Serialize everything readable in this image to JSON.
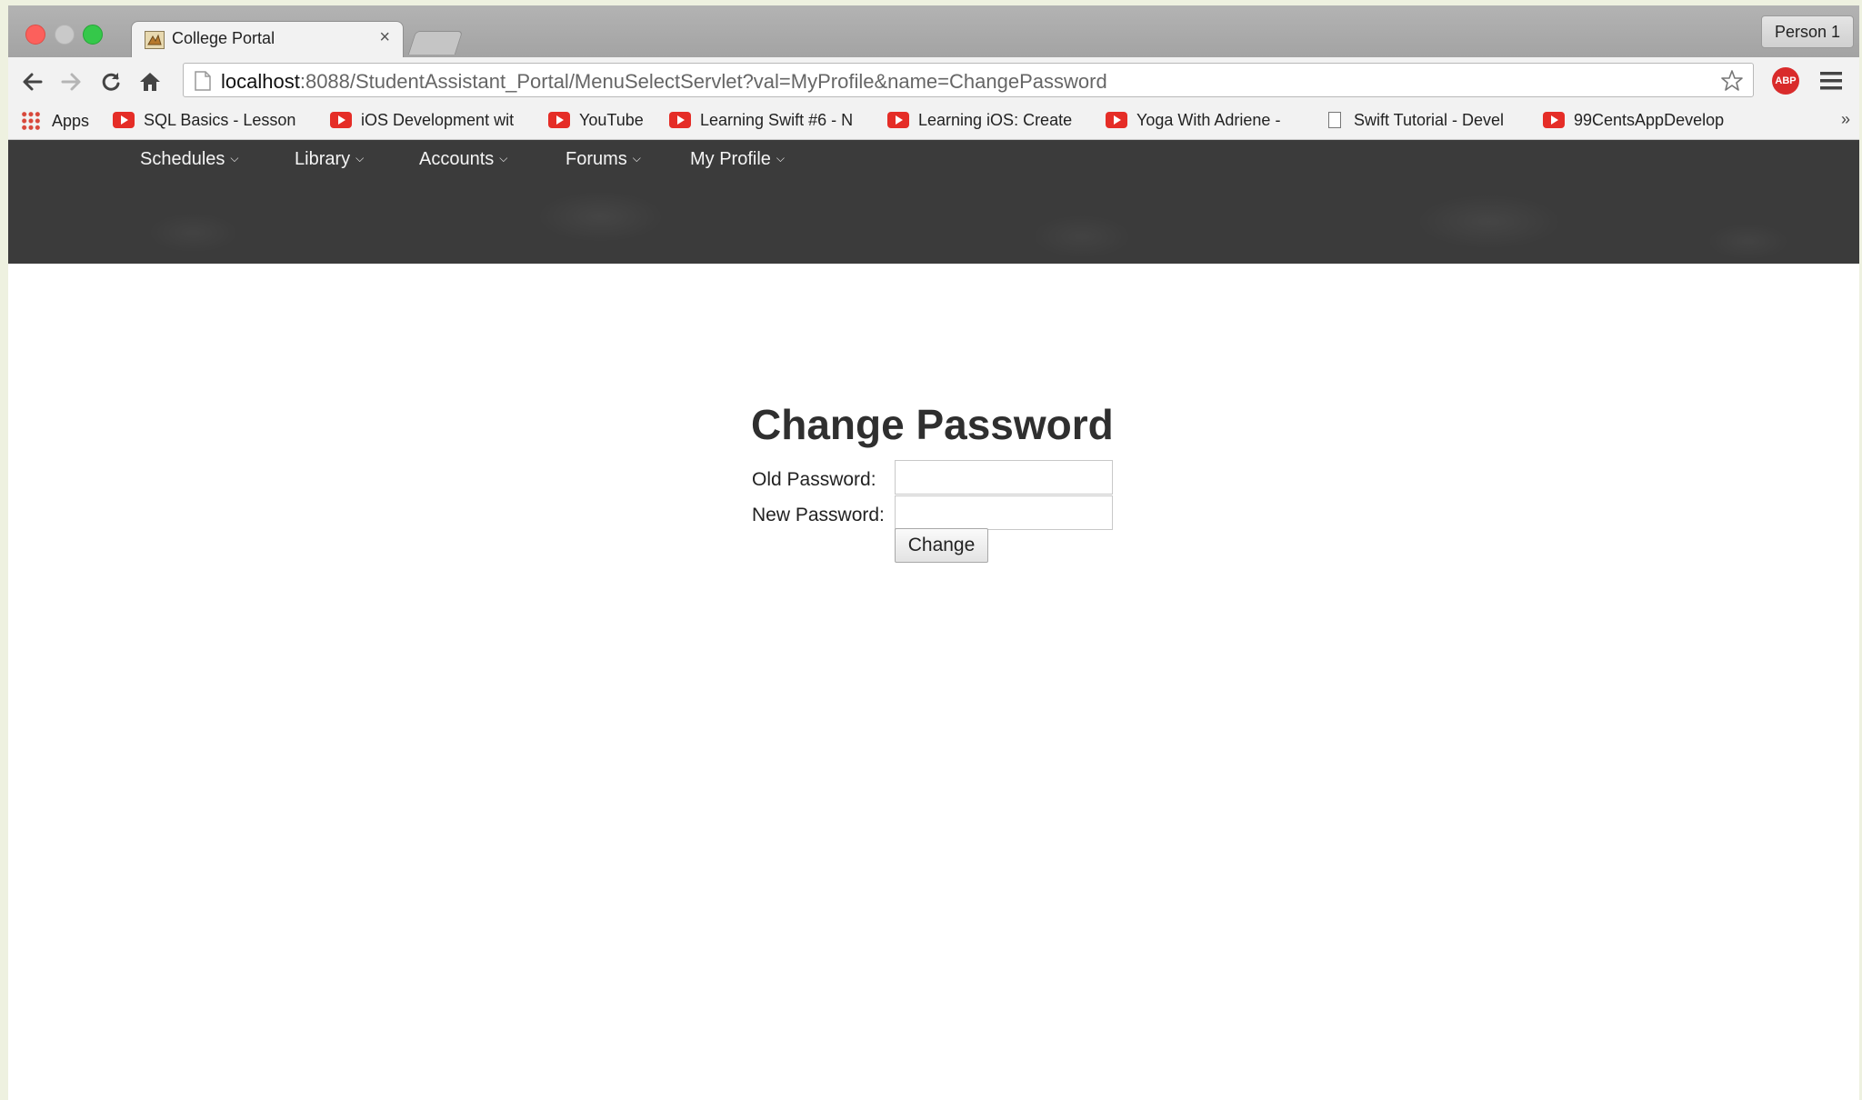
{
  "browser": {
    "tab_title": "College Portal",
    "tab_close": "×",
    "profile_button": "Person 1",
    "url_host": "localhost",
    "url_rest": ":8088/StudentAssistant_Portal/MenuSelectServlet?val=MyProfile&name=ChangePassword",
    "abp_label": "ABP",
    "bookmarks_overflow": "»"
  },
  "bookmarks": [
    {
      "label": "Apps",
      "icon": "apps-grid-icon"
    },
    {
      "label": "SQL Basics - Lesson",
      "icon": "youtube-icon"
    },
    {
      "label": "iOS Development wit",
      "icon": "youtube-icon"
    },
    {
      "label": "YouTube",
      "icon": "youtube-icon"
    },
    {
      "label": "Learning Swift #6 - N",
      "icon": "youtube-icon"
    },
    {
      "label": "Learning iOS: Create",
      "icon": "youtube-icon"
    },
    {
      "label": "Yoga With Adriene -",
      "icon": "youtube-icon"
    },
    {
      "label": "Swift Tutorial - Devel",
      "icon": "document-icon"
    },
    {
      "label": "99CentsAppDevelop",
      "icon": "youtube-icon"
    }
  ],
  "site_nav": {
    "items": [
      "Schedules",
      "Library",
      "Accounts",
      "Forums",
      "My Profile"
    ],
    "chevron": "⌵"
  },
  "form": {
    "title": "Change Password",
    "old_password_label": "Old Password:",
    "old_password_value": "",
    "new_password_label": "New Password:",
    "new_password_value": "",
    "submit_label": "Change"
  },
  "colors": {
    "nav_background": "#3b3b3b",
    "youtube_red": "#e52d27",
    "abp_red": "#d92b2b"
  }
}
